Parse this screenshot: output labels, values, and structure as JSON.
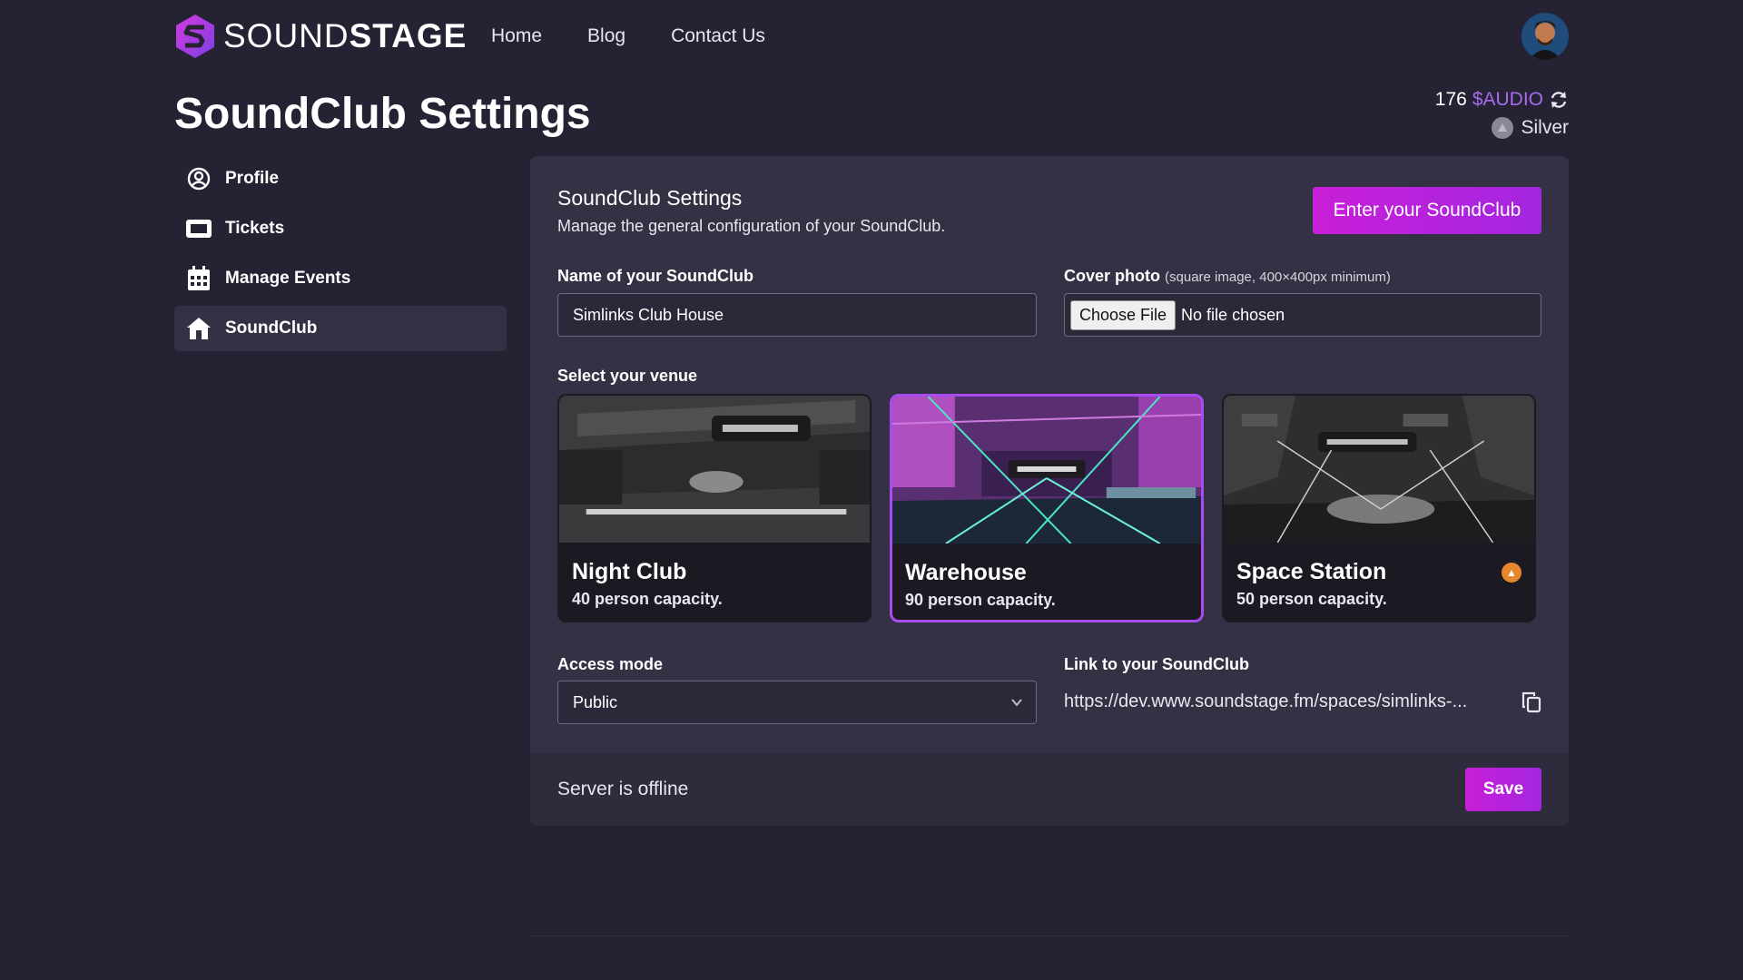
{
  "nav": {
    "brand_a": "SOUND",
    "brand_b": "STAGE",
    "links": [
      "Home",
      "Blog",
      "Contact Us"
    ]
  },
  "page": {
    "title": "SoundClub Settings",
    "balance_amount": "176",
    "balance_token": "$AUDIO",
    "tier": "Silver"
  },
  "sidebar": {
    "items": [
      {
        "label": "Profile",
        "icon": "user-circle-icon"
      },
      {
        "label": "Tickets",
        "icon": "ticket-icon"
      },
      {
        "label": "Manage Events",
        "icon": "calendar-icon"
      },
      {
        "label": "SoundClub",
        "icon": "house-icon",
        "active": true
      }
    ]
  },
  "panel": {
    "title": "SoundClub Settings",
    "subtitle": "Manage the general configuration of your SoundClub.",
    "enter_button": "Enter your SoundClub",
    "name_label": "Name of your SoundClub",
    "name_value": "Simlinks Club House",
    "cover_label": "Cover photo",
    "cover_hint": "(square image, 400×400px minimum)",
    "choose_file": "Choose File",
    "no_file": "No file chosen",
    "venue_label": "Select your venue",
    "venues": [
      {
        "name": "Night Club",
        "capacity": "40 person capacity.",
        "selected": false
      },
      {
        "name": "Warehouse",
        "capacity": "90 person capacity.",
        "selected": true
      },
      {
        "name": "Space Station",
        "capacity": "50 person capacity.",
        "selected": false,
        "premium": true
      }
    ],
    "access_label": "Access mode",
    "access_value": "Public",
    "link_label": "Link to your SoundClub",
    "link_value": "https://dev.www.soundstage.fm/spaces/simlinks-...",
    "status": "Server is offline",
    "save": "Save"
  },
  "colors": {
    "background": "#252233",
    "panel": "#353145",
    "accent": "#c81fd8",
    "token": "#a56cf0"
  }
}
